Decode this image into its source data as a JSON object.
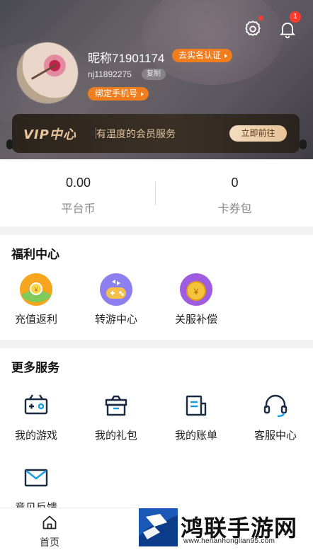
{
  "header": {
    "nickname": "昵称71901174",
    "realname_button": "去实名认证",
    "account_id": "nj11892275",
    "copy_button": "复制",
    "bind_phone_button": "绑定手机号",
    "notification_count": "1",
    "vip": {
      "title": "VIP中心",
      "desc": "有温度的会员服务",
      "button": "立即前往"
    }
  },
  "wallet": [
    {
      "value": "0.00",
      "label": "平台币"
    },
    {
      "value": "0",
      "label": "卡券包"
    }
  ],
  "welfare": {
    "title": "福利中心",
    "items": [
      {
        "label": "充值返利",
        "icon": "recharge-rebate-icon"
      },
      {
        "label": "转游中心",
        "icon": "game-transfer-icon"
      },
      {
        "label": "关服补偿",
        "icon": "server-compensation-icon"
      }
    ]
  },
  "services": {
    "title": "更多服务",
    "items": [
      {
        "label": "我的游戏",
        "icon": "gamepad-icon"
      },
      {
        "label": "我的礼包",
        "icon": "gift-icon"
      },
      {
        "label": "我的账单",
        "icon": "bill-icon"
      },
      {
        "label": "客服中心",
        "icon": "headset-icon"
      },
      {
        "label": "意见反馈",
        "icon": "mail-icon"
      }
    ]
  },
  "tabbar": {
    "home": "首页"
  },
  "watermark": {
    "title": "鸿联手游网",
    "url": "www.henanhonglian95.com"
  },
  "colors": {
    "accent_orange": "#f07d1e",
    "vip_gold": "#e7c49a",
    "badge_red": "#ff3b30"
  }
}
